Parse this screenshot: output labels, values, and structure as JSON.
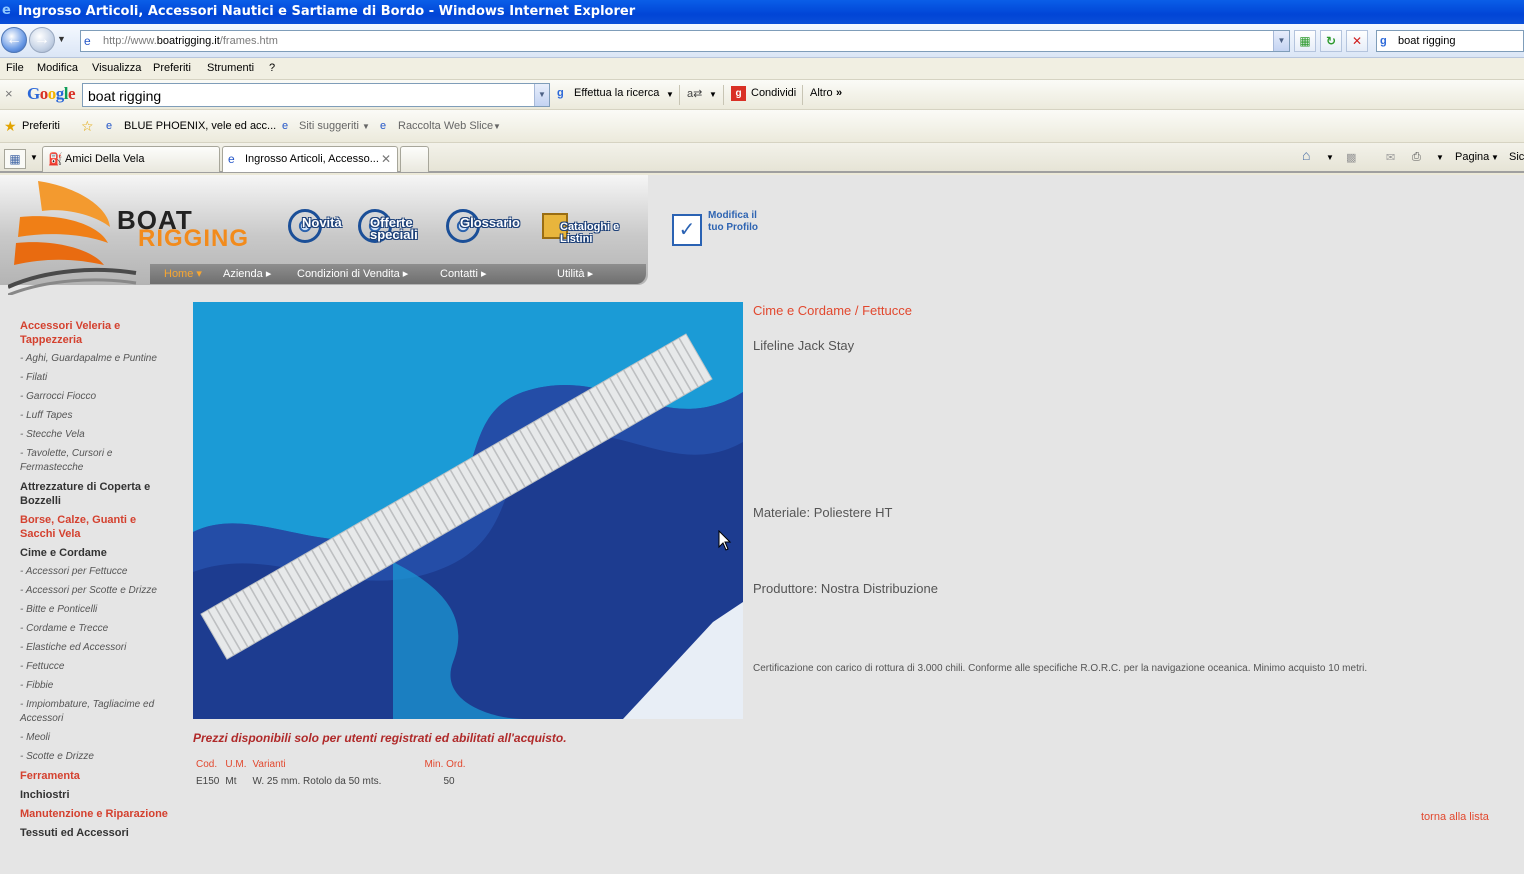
{
  "window": {
    "title": "Ingrosso Articoli, Accessori Nautici e Sartiame di Bordo - Windows Internet Explorer"
  },
  "address": {
    "url_prefix": "http://www.",
    "url_domain": "boatrigging.it",
    "url_path": "/frames.htm"
  },
  "live_search": {
    "value": "boat rigging"
  },
  "menu": [
    "File",
    "Modifica",
    "Visualizza",
    "Preferiti",
    "Strumenti",
    "?"
  ],
  "google_toolbar": {
    "logo": "Google",
    "query": "boat rigging",
    "search_btn": "Effettua la ricerca",
    "share_btn": "Condividi",
    "more_btn": "Altro"
  },
  "favorites": {
    "label": "Preferiti",
    "items": [
      "BLUE PHOENIX, vele ed acc...",
      "Siti suggeriti",
      "Raccolta Web Slice"
    ]
  },
  "tabs": [
    {
      "label": "Amici Della Vela"
    },
    {
      "label": "Ingrosso Articoli, Accesso..."
    }
  ],
  "command_bar": {
    "page": "Pagina",
    "safety": "Sic"
  },
  "site": {
    "brand_top": "BOAT",
    "brand_bottom": "RIGGING",
    "top_buttons": [
      "Novità",
      "Offerte speciali",
      "Glossario",
      "Cataloghi e Listini"
    ],
    "nav": [
      "Home",
      "Azienda",
      "Condizioni di Vendita",
      "Contatti",
      "Utilità"
    ],
    "profile": "Modifica il tuo Profilo"
  },
  "sidebar": [
    {
      "text": "Accessori Veleria e Tappezzeria",
      "kind": "cat-red"
    },
    {
      "text": "- Aghi, Guardapalme e Puntine",
      "kind": "sub"
    },
    {
      "text": "- Filati",
      "kind": "sub"
    },
    {
      "text": "- Garrocci Fiocco",
      "kind": "sub"
    },
    {
      "text": "- Luff Tapes",
      "kind": "sub"
    },
    {
      "text": "- Stecche Vela",
      "kind": "sub"
    },
    {
      "text": "- Tavolette, Cursori e Fermastecche",
      "kind": "sub"
    },
    {
      "text": "Attrezzature di Coperta e Bozzelli",
      "kind": "cat"
    },
    {
      "text": "Borse, Calze, Guanti e Sacchi Vela",
      "kind": "cat-red"
    },
    {
      "text": "Cime e Cordame",
      "kind": "cat"
    },
    {
      "text": "- Accessori per Fettucce",
      "kind": "sub"
    },
    {
      "text": "- Accessori per Scotte e Drizze",
      "kind": "sub"
    },
    {
      "text": "- Bitte e Ponticelli",
      "kind": "sub"
    },
    {
      "text": "- Cordame e Trecce",
      "kind": "sub"
    },
    {
      "text": "- Elastiche ed Accessori",
      "kind": "sub"
    },
    {
      "text": "- Fettucce",
      "kind": "sub"
    },
    {
      "text": "- Fibbie",
      "kind": "sub"
    },
    {
      "text": "- Impiombature, Tagliacime ed Accessori",
      "kind": "sub"
    },
    {
      "text": "- Meoli",
      "kind": "sub"
    },
    {
      "text": "- Scotte e Drizze",
      "kind": "sub"
    },
    {
      "text": "Ferramenta",
      "kind": "cat-red"
    },
    {
      "text": "Inchiostri",
      "kind": "cat"
    },
    {
      "text": "Manutenzione e Riparazione",
      "kind": "cat-red"
    },
    {
      "text": "Tessuti ed Accessori",
      "kind": "cat"
    }
  ],
  "product": {
    "breadcrumb": "Cime e Cordame / Fettucce",
    "title": "Lifeline Jack Stay",
    "material": "Materiale: Poliestere HT",
    "producer": "Produttore: Nostra Distribuzione",
    "description": "Certificazione con carico di rottura di 3.000 chili. Conforme alle specifiche R.O.R.C. per la navigazione oceanica. Minimo acquisto 10 metri.",
    "price_note": "Prezzi disponibili solo per utenti registrati ed abilitati all'acquisto.",
    "table_headers": [
      "Cod.",
      "U.M.",
      "Varianti",
      "Min. Ord."
    ],
    "rows": [
      [
        "E150",
        "Mt",
        "W. 25 mm. Rotolo da 50 mts.",
        "50"
      ]
    ],
    "back_link": "torna alla lista"
  }
}
